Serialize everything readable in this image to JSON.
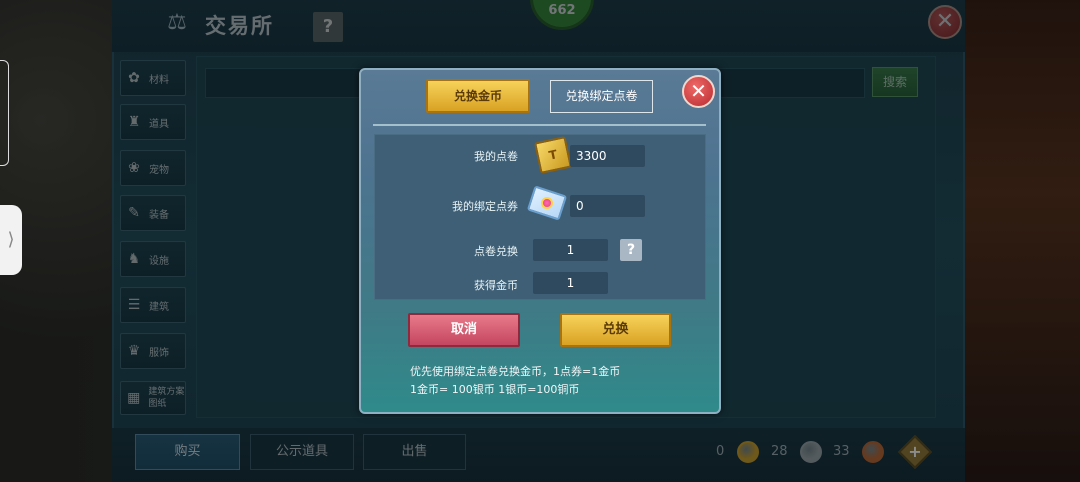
{
  "header": {
    "title": "交易所",
    "help": "?",
    "badge": "662"
  },
  "search": {
    "button": "搜索"
  },
  "sidebar": {
    "items": [
      {
        "label": "材料",
        "icon": "materials-icon",
        "glyph": "✿"
      },
      {
        "label": "道具",
        "icon": "tool-icon",
        "glyph": "♜"
      },
      {
        "label": "宠物",
        "icon": "paw-icon",
        "glyph": "❀"
      },
      {
        "label": "装备",
        "icon": "equipment-icon",
        "glyph": "✎"
      },
      {
        "label": "设施",
        "icon": "facility-icon",
        "glyph": "♞"
      },
      {
        "label": "建筑",
        "icon": "building-icon",
        "glyph": "☰"
      },
      {
        "label": "服饰",
        "icon": "clothing-icon",
        "glyph": "♛"
      },
      {
        "label": "建筑方案图纸",
        "icon": "blueprint-icon",
        "glyph": "▦"
      }
    ]
  },
  "bottom": {
    "tabs": [
      "购买",
      "公示道具",
      "出售"
    ],
    "currency": [
      {
        "value": "0",
        "color": "#c9a030"
      },
      {
        "value": "28",
        "color": "#9aa6ac"
      },
      {
        "value": "33",
        "color": "#b86a3a"
      }
    ]
  },
  "dialog": {
    "tabs": {
      "gold": "兑换金币",
      "bound": "兑换绑定点卷"
    },
    "close": "✕",
    "my_tickets_label": "我的点卷",
    "my_tickets": "3300",
    "ticket_icon_text": "T",
    "my_bound_label": "我的绑定点券",
    "my_bound": "0",
    "exchange_label": "点卷兑换",
    "exchange_value": "1",
    "help": "?",
    "gain_label": "获得金币",
    "gain_value": "1",
    "cancel": "取消",
    "confirm": "兑换",
    "note1": "优先使用绑定点卷兑换金币，1点券=1金币",
    "note2": "1金币= 100银币  1银币=100铜币"
  }
}
